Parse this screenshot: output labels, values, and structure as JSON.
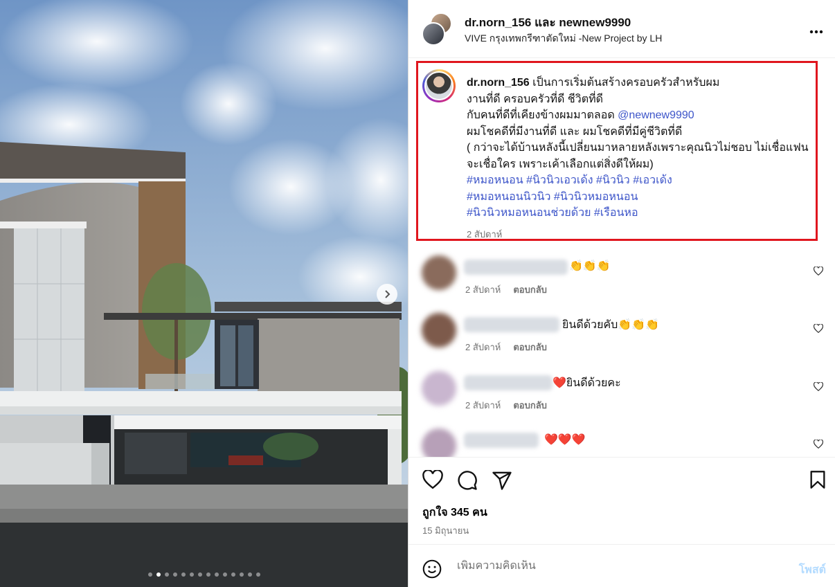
{
  "post": {
    "header": {
      "users": "dr.norn_156 และ newnew9990",
      "location": "VIVE กรุงเทพกรีฑาตัดใหม่ -New Project by LH",
      "more_icon": "more-horizontal-icon"
    },
    "media": {
      "carousel_dots": 14,
      "active_dot": 1
    },
    "caption": {
      "username": "dr.norn_156",
      "line1": " เป็นการเริ่มต้นสร้างครอบครัวสำหรับผม",
      "line2": "งานที่ดี ครอบครัวที่ดี ชีวิตที่ดี",
      "line3": "กับคนที่ดีที่เคียงข้างผมมาตลอด ",
      "mention": "@newnew9990",
      "line4": "ผมโชคดีที่มีงานที่ดี และ ผมโชคดีที่มีคู่ชีวิตที่ดี",
      "line5": "( กว่าจะได้บ้านหลังนี้เปลี่ยนมาหลายหลังเพราะคุณนิวไม่ชอบ ไม่เชื่อแฟน จะเชื่อใคร เพราะเค้าเลือกแต่สิ่งดีให้ผม)",
      "hashtags_line1": "#หมอหนอน #นิวนิวเอวเด้ง #นิวนิว #เอวเด้ง",
      "hashtags_line2": "#หมอหนอนนิวนิว #นิวนิวหมอหนอน",
      "hashtags_line3": "#นิวนิวหมอหนอนช่วยด้วย #เรือนหอ",
      "time": "2 สัปดาห์"
    },
    "comments": [
      {
        "text": "👏👏👏",
        "time": "2 สัปดาห์",
        "reply": "ตอบกลับ"
      },
      {
        "text": "ยินดีด้วยคับ👏👏👏",
        "time": "2 สัปดาห์",
        "reply": "ตอบกลับ"
      },
      {
        "text": "❤️ยินดีด้วยคะ",
        "time": "2 สัปดาห์",
        "reply": "ตอบกลับ"
      },
      {
        "text": "❤️❤️❤️"
      }
    ],
    "likes": "ถูกใจ 345 คน",
    "date": "15 มิถุนายน",
    "add_comment": {
      "placeholder": "เพิ่มความคิดเห็น",
      "post_label": "โพสต์"
    },
    "colors": {
      "highlight_border": "#e0161e",
      "link": "#3d55c9",
      "muted": "#737373"
    }
  }
}
